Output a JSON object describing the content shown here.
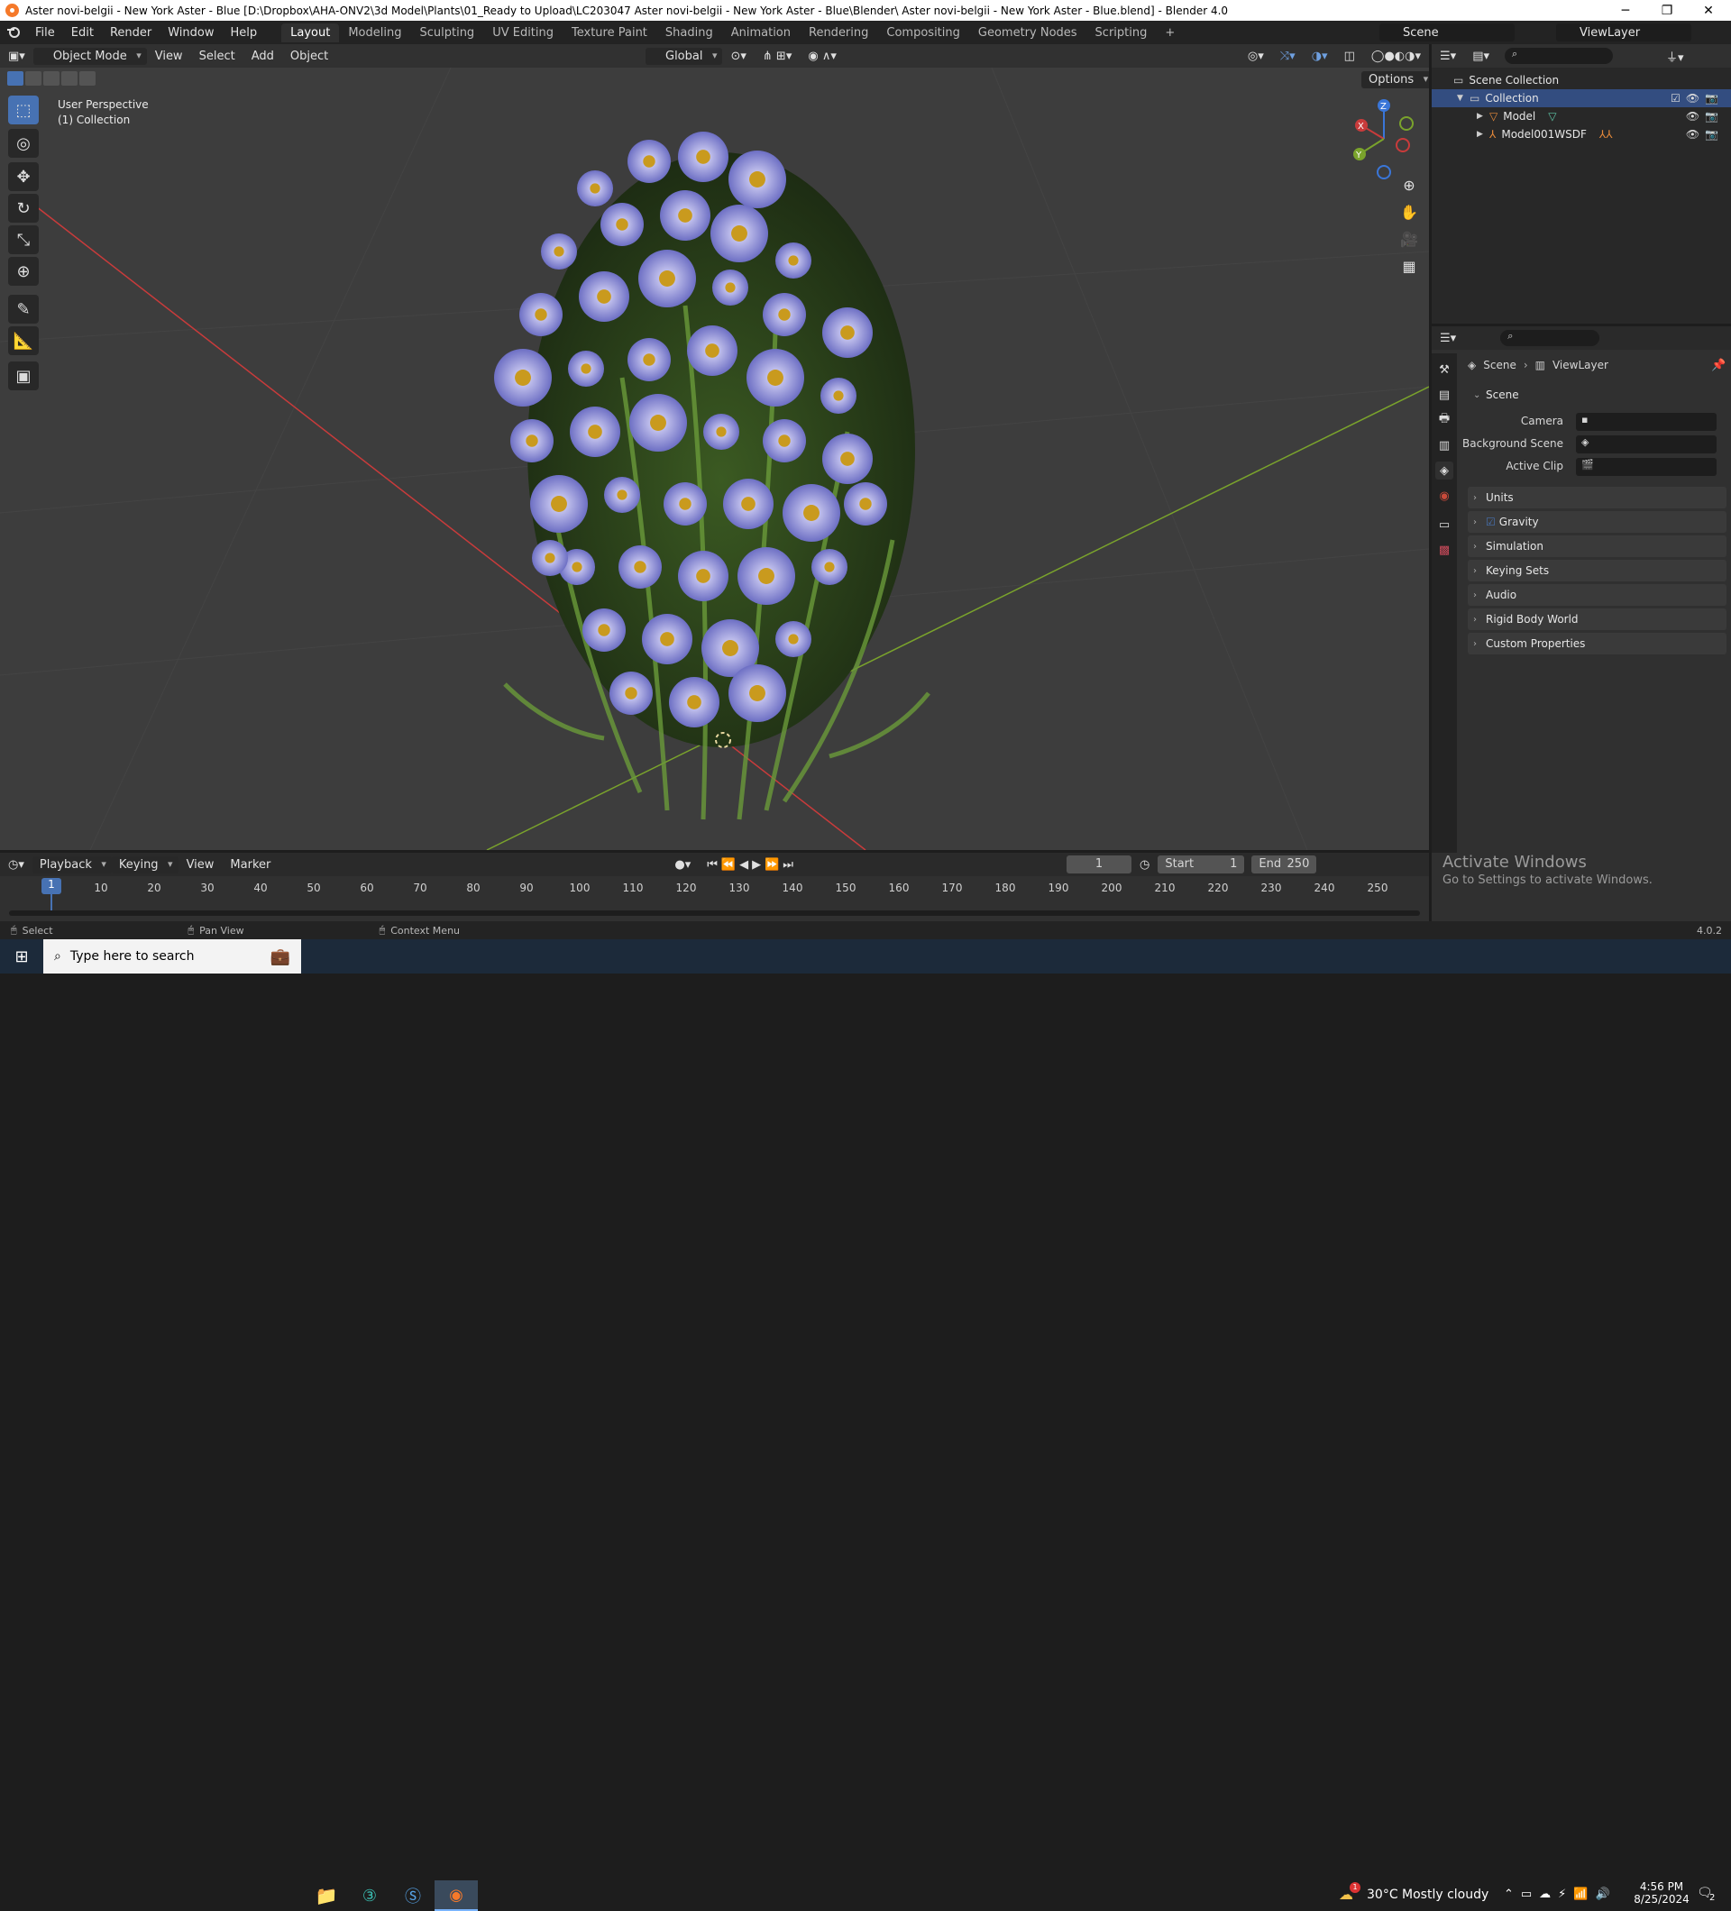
{
  "window": {
    "title": "Aster novi-belgii - New York Aster - Blue [D:\\Dropbox\\AHA-ONV2\\3d Model\\Plants\\01_Ready to Upload\\LC203047 Aster novi-belgii - New York Aster - Blue\\Blender\\ Aster novi-belgii - New York Aster - Blue.blend] - Blender 4.0",
    "controls": {
      "minimize": "─",
      "restore": "❐",
      "close": "✕"
    }
  },
  "menu": {
    "items": [
      "File",
      "Edit",
      "Render",
      "Window",
      "Help"
    ],
    "workspaces": [
      "Layout",
      "Modeling",
      "Sculpting",
      "UV Editing",
      "Texture Paint",
      "Shading",
      "Animation",
      "Rendering",
      "Compositing",
      "Geometry Nodes",
      "Scripting"
    ],
    "add_workspace": "+",
    "active_workspace": "Layout",
    "scene": "Scene",
    "view_layer": "ViewLayer"
  },
  "viewport": {
    "mode": "Object Mode",
    "menus": [
      "View",
      "Select",
      "Add",
      "Object"
    ],
    "transform_orientation": "Global",
    "options": "Options",
    "overlay_line1": "User Perspective",
    "overlay_line2": "(1) Collection",
    "gizmo_labels": {
      "z": "Z",
      "y": "Y",
      "x": "X"
    },
    "grid_colors": {
      "x_axis": "#c93b3b",
      "y_axis": "#7aa32c",
      "background": "#3d3d3d"
    }
  },
  "outliner": {
    "scene_collection": "Scene Collection",
    "collection": "Collection",
    "items": [
      {
        "name": "Model"
      },
      {
        "name": "Model001WSDF"
      }
    ]
  },
  "properties": {
    "breadcrumb_scene": "Scene",
    "breadcrumb_viewlayer": "ViewLayer",
    "panel_title": "Scene",
    "fields": [
      {
        "label": "Camera"
      },
      {
        "label": "Background Scene"
      },
      {
        "label": "Active Clip"
      }
    ],
    "sections": [
      {
        "label": "Units",
        "checkbox": false
      },
      {
        "label": "Gravity",
        "checkbox": true
      },
      {
        "label": "Simulation",
        "checkbox": false
      },
      {
        "label": "Keying Sets",
        "checkbox": false
      },
      {
        "label": "Audio",
        "checkbox": false
      },
      {
        "label": "Rigid Body World",
        "checkbox": false
      },
      {
        "label": "Custom Properties",
        "checkbox": false
      }
    ]
  },
  "timeline": {
    "menus": [
      "Playback",
      "Keying",
      "View",
      "Marker"
    ],
    "current_frame": "1",
    "start_label": "Start",
    "start": "1",
    "end_label": "End",
    "end": "250",
    "ticks": [
      "10",
      "20",
      "30",
      "40",
      "50",
      "60",
      "70",
      "80",
      "90",
      "100",
      "110",
      "120",
      "130",
      "140",
      "150",
      "160",
      "170",
      "180",
      "190",
      "200",
      "210",
      "220",
      "230",
      "240",
      "250"
    ],
    "playhead": "1"
  },
  "watermark": {
    "line1": "Activate Windows",
    "line2": "Go to Settings to activate Windows."
  },
  "statusbar": {
    "select": "Select",
    "pan": "Pan View",
    "context": "Context Menu",
    "version": "4.0.2"
  },
  "taskbar": {
    "search_placeholder": "Type here to search",
    "weather": "30°C  Mostly cloudy",
    "weather_badge": "1",
    "time": "4:56 PM",
    "date": "8/25/2024",
    "notifications": "2"
  }
}
